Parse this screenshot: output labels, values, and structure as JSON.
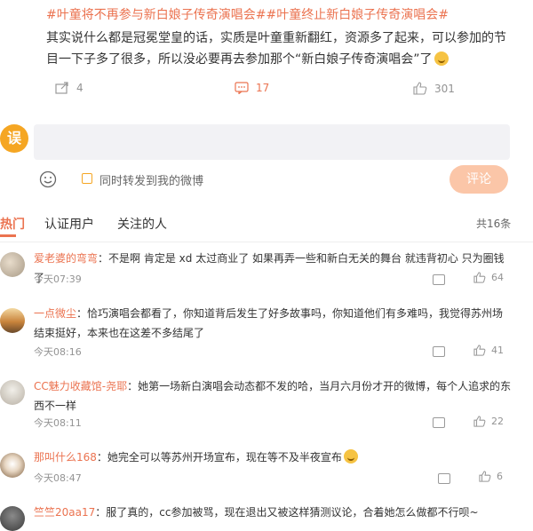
{
  "post": {
    "tags": "#叶童将不再参与新白娘子传奇演唱会##叶童终止新白娘子传奇演唱会#",
    "body": "其实说什么都是冠冕堂皇的话，实质是叶童重新翻红，资源多了起来，可以参加的节目一下子多了很多，所以没必要再去参加那个“新白娘子传奇演唱会”了",
    "emoji_icon": "laughing-face-icon",
    "repost_count": "4",
    "comment_count": "17",
    "like_count": "301"
  },
  "composer": {
    "avatar_char": "误",
    "placeholder": "",
    "repost_label": "同时转发到我的微博",
    "submit_label": "评论"
  },
  "tabs": {
    "hot": "热门",
    "verified": "认证用户",
    "following": "关注的人"
  },
  "total": "共16条",
  "comments": [
    {
      "user": "爱老婆的弯弯",
      "sep": "：",
      "text": "不是啊 肯定是 xd 太过商业了 如果再弄一些和新白无关的舞台 就违背初心 只为圈钱了",
      "time": "今天07:39",
      "likes": "64"
    },
    {
      "user": "一点微尘",
      "sep": "：",
      "text": "恰巧演唱会都看了，你知道背后发生了好多故事吗，你知道他们有多难吗，我觉得苏州场结束挺好，本来也在这差不多结尾了",
      "time": "今天08:16",
      "likes": "41"
    },
    {
      "user": "CC魅力收藏馆-尧耶",
      "sep": "：",
      "text": "她第一场新白演唱会动态都不发的哈，当月六月份才开的微博，每个人追求的东西不一样",
      "time": "今天08:11",
      "likes": "22"
    },
    {
      "user": "那叫什么168",
      "sep": "：",
      "text": "她完全可以等苏州开场宣布，现在等不及半夜宣布",
      "time": "今天08:47",
      "likes": "6"
    },
    {
      "user": "竺竺20aa17",
      "sep": "：",
      "text": "服了真的，cc参加被骂，现在退出又被这样猜测议论，合着她怎么做都不行呗~",
      "time": "",
      "likes": ""
    }
  ]
}
